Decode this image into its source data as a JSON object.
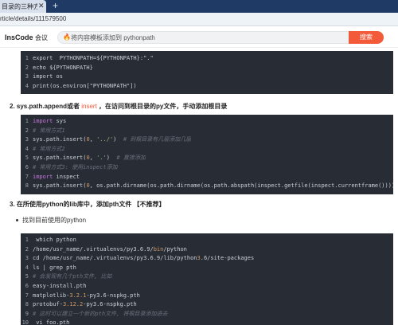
{
  "browser": {
    "tab_title": "目录的三种方法_l",
    "tab_close": "✕",
    "tab_new": "+",
    "url": "rticle/details/111579500"
  },
  "header": {
    "logo": "InsCode",
    "nav_vip": "会议",
    "search_placeholder": "将内容模板添加到 pythonpath",
    "search_button": "搜索"
  },
  "code_block_1": [
    {
      "n": "1",
      "parts": [
        [
          "t",
          "export  PYTHONPATH=${PYTHONPATH}:\".\""
        ]
      ]
    },
    {
      "n": "2",
      "parts": [
        [
          "t",
          "echo ${PYTHONPATH}"
        ]
      ]
    },
    {
      "n": "3",
      "parts": [
        [
          "t",
          "import os"
        ]
      ]
    },
    {
      "n": "4",
      "parts": [
        [
          "t",
          "print(os.environ[\"PYTHONPATH\"])"
        ]
      ]
    }
  ],
  "heading_2": {
    "prefix": "2. sys.path.append或者 ",
    "link": "insert",
    "suffix": " ，在访问到根目录的py文件，手动添加根目录"
  },
  "code_block_2": [
    {
      "n": "1",
      "parts": [
        [
          "k",
          "import"
        ],
        [
          "t",
          " sys"
        ]
      ]
    },
    {
      "n": "2",
      "parts": [
        [
          "c",
          "# 常用方式1"
        ]
      ]
    },
    {
      "n": "3",
      "parts": [
        [
          "t",
          "sys.path.insert("
        ],
        [
          "m",
          "0"
        ],
        [
          "t",
          ", "
        ],
        [
          "s",
          "'../'"
        ],
        [
          "t",
          ")  "
        ],
        [
          "c",
          "# 到根目录有几层添加几层"
        ]
      ]
    },
    {
      "n": "4",
      "parts": [
        [
          "c",
          "# 常用方式2"
        ]
      ]
    },
    {
      "n": "5",
      "parts": [
        [
          "t",
          "sys.path.insert("
        ],
        [
          "m",
          "0"
        ],
        [
          "t",
          ", "
        ],
        [
          "s",
          "'.'"
        ],
        [
          "t",
          ")  "
        ],
        [
          "c",
          "# 直接添加"
        ]
      ]
    },
    {
      "n": "6",
      "parts": [
        [
          "c",
          "# 常用方式3: 使用inspect添加"
        ]
      ]
    },
    {
      "n": "7",
      "parts": [
        [
          "k",
          "import"
        ],
        [
          "t",
          " inspect"
        ]
      ]
    },
    {
      "n": "8",
      "parts": [
        [
          "t",
          "sys.path.insert("
        ],
        [
          "m",
          "0"
        ],
        [
          "t",
          ", os.path.dirname(os.path.dirname(os.path.abspath(inspect.getfile(inspect.currentframe())))))"
        ]
      ]
    }
  ],
  "heading_3": {
    "prefix": "3. 在所使用python的lib库中，添加pth文件 【不推荐】",
    "link": "",
    "suffix": ""
  },
  "bullet_1": "找到目前使用的python",
  "code_block_3": [
    {
      "n": "1",
      "parts": [
        [
          "t",
          " which python"
        ]
      ]
    },
    {
      "n": "2",
      "parts": [
        [
          "t",
          "/home/usr_name/.virtualenvs/py3.6.9/"
        ],
        [
          "m",
          "bin"
        ],
        [
          "t",
          "/python"
        ]
      ]
    },
    {
      "n": "3",
      "parts": [
        [
          "t",
          "cd /home/usr_name/.virtualenvs/py3.6.9/lib/python"
        ],
        [
          "m",
          "3"
        ],
        [
          "t",
          ".6/site-packages"
        ]
      ]
    },
    {
      "n": "4",
      "parts": [
        [
          "t",
          "ls | grep pth"
        ]
      ]
    },
    {
      "n": "5",
      "parts": [
        [
          "c",
          "# 会发现有几个pth文件, 比如"
        ]
      ]
    },
    {
      "n": "6",
      "parts": [
        [
          "t",
          "easy-install.pth"
        ]
      ]
    },
    {
      "n": "7",
      "parts": [
        [
          "t",
          "matplotlib-"
        ],
        [
          "m",
          "3.2.1"
        ],
        [
          "t",
          "-py3.6-nspkg.pth"
        ]
      ]
    },
    {
      "n": "8",
      "parts": [
        [
          "t",
          "protobuf-"
        ],
        [
          "m",
          "3.12.2"
        ],
        [
          "t",
          "-py3.6-nspkg.pth"
        ]
      ]
    },
    {
      "n": "9",
      "parts": [
        [
          "c",
          "# 这时可以建立一个新的pth文件, 将根目录添加进去"
        ]
      ]
    },
    {
      "n": "10",
      "parts": [
        [
          "t",
          " vi foo.pth"
        ]
      ]
    }
  ]
}
